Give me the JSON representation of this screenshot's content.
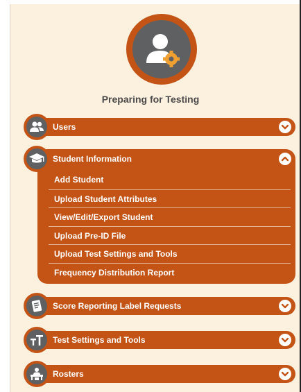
{
  "page": {
    "title": "Preparing for Testing"
  },
  "sections": [
    {
      "label": "Users",
      "icon": "users-icon",
      "expanded": false
    },
    {
      "label": "Student Information",
      "icon": "graduation-cap-icon",
      "expanded": true,
      "items": [
        "Add Student",
        "Upload Student Attributes",
        "View/Edit/Export Student",
        "Upload Pre-ID File",
        "Upload Test Settings and Tools",
        "Frequency Distribution Report"
      ]
    },
    {
      "label": "Score Reporting Label Requests",
      "icon": "label-icon",
      "expanded": false
    },
    {
      "label": "Test Settings and Tools",
      "icon": "text-size-icon",
      "expanded": false
    },
    {
      "label": "Rosters",
      "icon": "classroom-icon",
      "expanded": false
    }
  ],
  "colors": {
    "accent": "#c35416",
    "icon_gray": "#5f6062",
    "background": "#fcf0df"
  }
}
